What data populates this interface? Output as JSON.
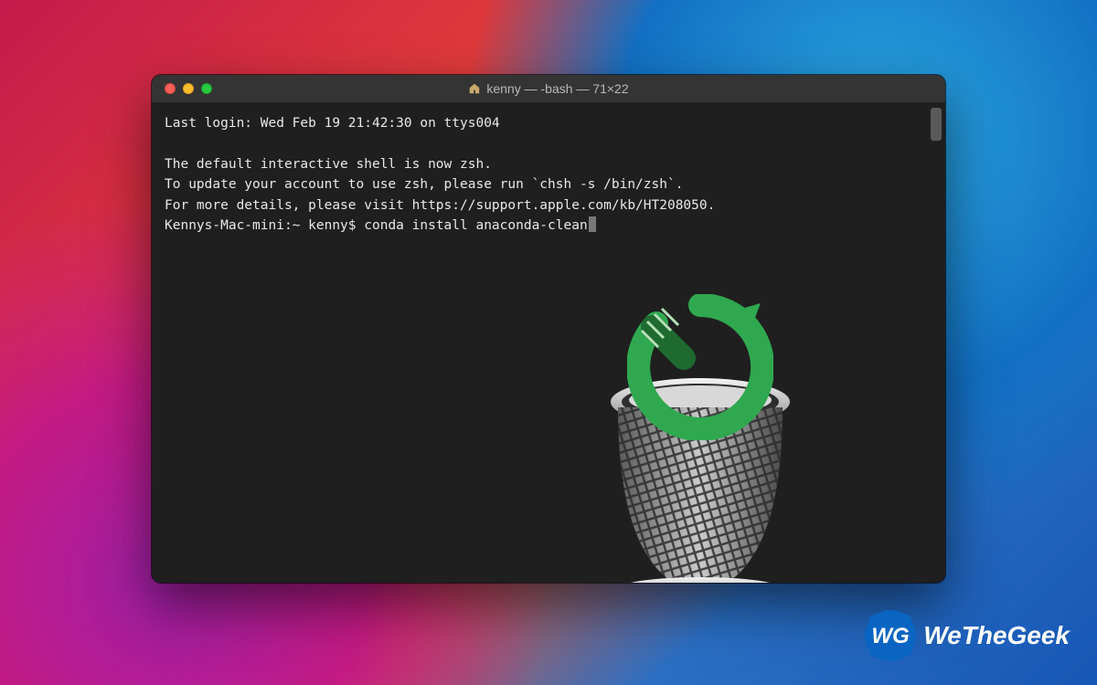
{
  "window": {
    "title": "kenny — -bash — 71×22",
    "traffic_light_colors": {
      "close": "#ff5f57",
      "minimize": "#febc2e",
      "zoom": "#28c840"
    }
  },
  "terminal": {
    "lines": [
      "Last login: Wed Feb 19 21:42:30 on ttys004",
      "",
      "The default interactive shell is now zsh.",
      "To update your account to use zsh, please run `chsh -s /bin/zsh`.",
      "For more details, please visit https://support.apple.com/kb/HT208050."
    ],
    "prompt": "Kennys-Mac-mini:~ kenny$ ",
    "command": "conda install anaconda-clean"
  },
  "overlay": {
    "icons": [
      "anaconda-logo-icon",
      "trash-bin-icon"
    ]
  },
  "watermark": {
    "text": "WeTheGeek",
    "badge_letters": "WG",
    "brand_color": "#0a65c2"
  }
}
